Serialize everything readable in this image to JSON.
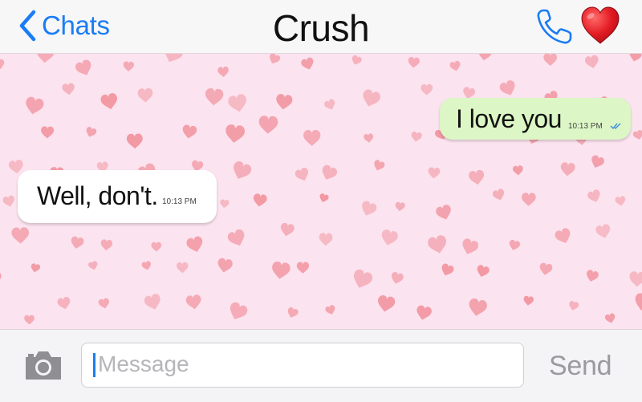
{
  "header": {
    "back_label": "Chats",
    "title": "Crush",
    "back_icon": "chevron-left-icon",
    "call_icon": "phone-icon",
    "status_icon": "red-heart-icon"
  },
  "messages": [
    {
      "direction": "outgoing",
      "text": "I love you",
      "time": "10:13 PM",
      "status": "read-double-check"
    },
    {
      "direction": "incoming",
      "text": "Well, don't.",
      "time": "10:13 PM"
    }
  ],
  "input": {
    "placeholder": "Message",
    "send_label": "Send",
    "camera_icon": "camera-icon"
  },
  "colors": {
    "accent": "#1a7cf5",
    "chat_background": "#fbe3ef",
    "outgoing_bubble": "#dcf7c5",
    "incoming_bubble": "#ffffff",
    "background_hearts": "#f08a95",
    "header_heart": "#e0202a"
  }
}
